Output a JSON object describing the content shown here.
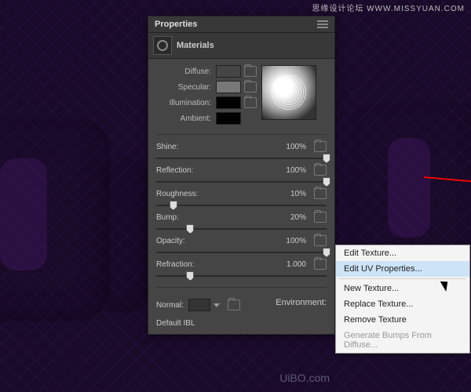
{
  "watermark_top": "思缘设计论坛  WWW.MISSYUAN.COM",
  "watermark_bottom": "UiBO.com",
  "panel": {
    "title": "Properties",
    "section": "Materials",
    "colors": {
      "diffuse_label": "Diffuse:",
      "specular_label": "Specular:",
      "illumination_label": "Illumination:",
      "ambient_label": "Ambient:",
      "diffuse": "#808080",
      "specular": "#787878",
      "illumination": "#000000",
      "ambient": "#000000"
    },
    "sliders": {
      "shine": {
        "label": "Shine:",
        "value": "100%",
        "pos": 100
      },
      "reflection": {
        "label": "Reflection:",
        "value": "100%",
        "pos": 100
      },
      "roughness": {
        "label": "Roughness:",
        "value": "10%",
        "pos": 10
      },
      "bump": {
        "label": "Bump:",
        "value": "20%",
        "pos": 20
      },
      "opacity": {
        "label": "Opacity:",
        "value": "100%",
        "pos": 100
      },
      "refraction": {
        "label": "Refraction:",
        "value": "1.000",
        "pos": 20
      }
    },
    "normal_label": "Normal:",
    "environment_label": "Environment:",
    "default_ibl": "Default IBL"
  },
  "context_menu": {
    "items": [
      "Edit Texture...",
      "Edit UV Properties...",
      "New Texture...",
      "Replace Texture...",
      "Remove Texture",
      "Generate Bumps From Diffuse..."
    ]
  }
}
